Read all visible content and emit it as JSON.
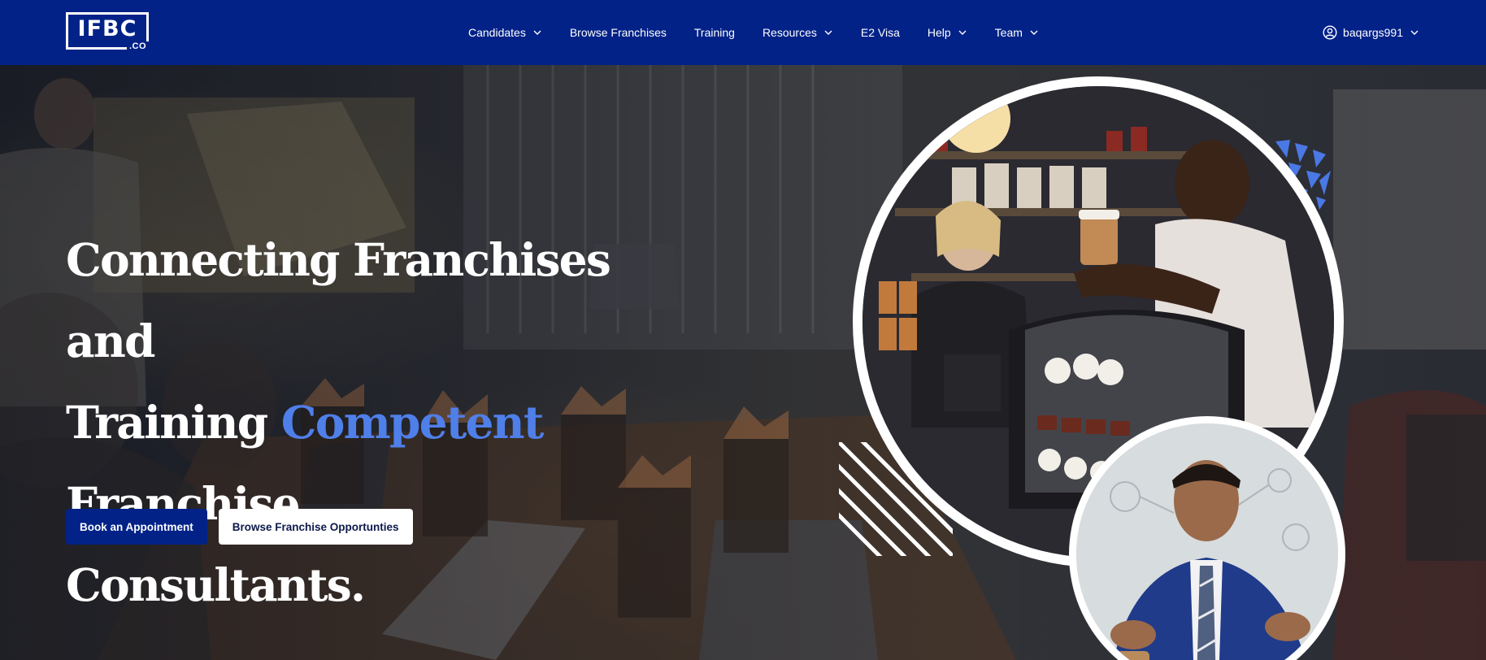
{
  "brand": {
    "logo_text": "IFBC",
    "logo_suffix": ".CO"
  },
  "nav": {
    "items": [
      {
        "label": "Candidates",
        "has_dropdown": true
      },
      {
        "label": "Browse Franchises",
        "has_dropdown": false
      },
      {
        "label": "Training",
        "has_dropdown": false
      },
      {
        "label": "Resources",
        "has_dropdown": true
      },
      {
        "label": "E2 Visa",
        "has_dropdown": false
      },
      {
        "label": "Help",
        "has_dropdown": true
      },
      {
        "label": "Team",
        "has_dropdown": true
      }
    ],
    "user": {
      "username": "baqargs991",
      "icon": "user-circle-icon"
    }
  },
  "hero": {
    "headline_line1": "Connecting Franchises and",
    "headline_line2_start": "Training",
    "headline_accent": "Competent",
    "headline_line2_end": "Franchise",
    "headline_line3": "Consultants.",
    "primary_button": "Book an Appointment",
    "secondary_button": "Browse Franchise Opportunties"
  },
  "colors": {
    "nav_bg": "#022288",
    "accent_text": "#4f7fe9",
    "primary_button_bg": "#022288",
    "secondary_button_bg": "#ffffff",
    "deco_blue": "#4a78e4"
  }
}
